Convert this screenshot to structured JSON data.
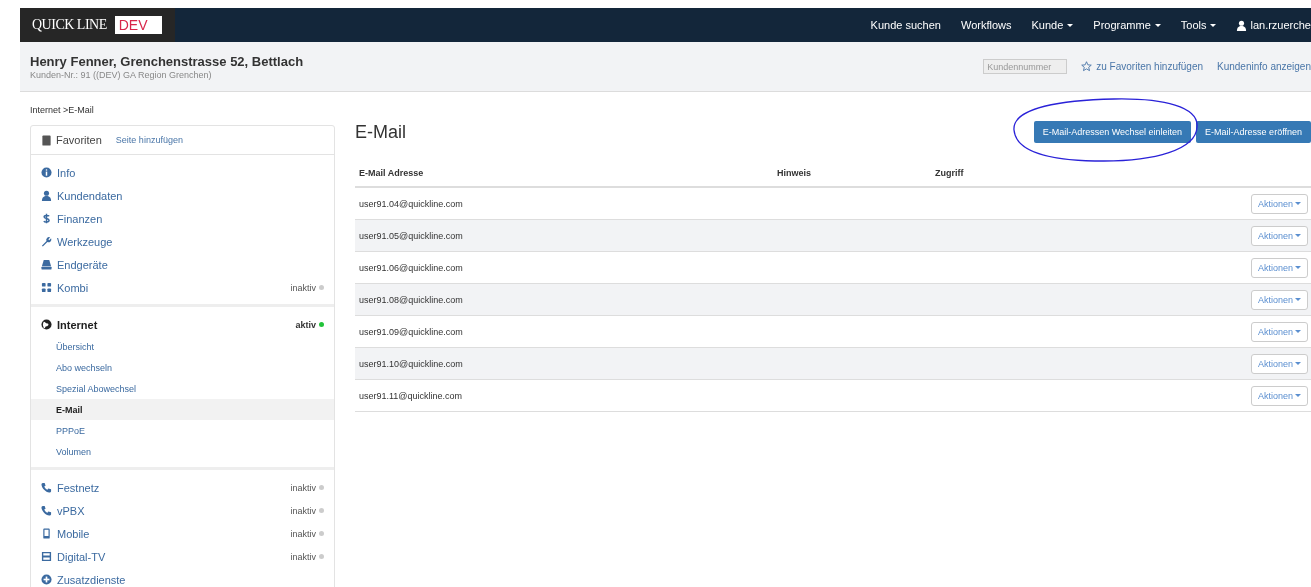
{
  "navbar": {
    "logo": "QUICK LINE",
    "env_badge": "DEV",
    "links": [
      {
        "label": "Kunde suchen",
        "dropdown": false
      },
      {
        "label": "Workflows",
        "dropdown": false
      },
      {
        "label": "Kunde",
        "dropdown": true
      },
      {
        "label": "Programme",
        "dropdown": true
      },
      {
        "label": "Tools",
        "dropdown": true
      }
    ],
    "user": "lan.rzuerche"
  },
  "customer_header": {
    "title": "Henry Fenner, Grenchenstrasse 52, Bettlach",
    "subtitle": "Kunden-Nr.: 91 ((DEV) GA Region Grenchen)",
    "search": {
      "placeholder": "Kundennummer"
    },
    "favorite_link": "zu Favoriten hinzufügen",
    "info_link": "Kundeninfo anzeigen"
  },
  "breadcrumb": "Internet >E-Mail",
  "sidebar": {
    "favorites": {
      "title": "Favoriten",
      "add_link": "Seite hinzufügen"
    },
    "groups": [
      {
        "items": [
          {
            "label": "Info",
            "expanded": false
          },
          {
            "label": "Kundendaten",
            "expanded": false
          },
          {
            "label": "Finanzen",
            "expanded": false
          },
          {
            "label": "Werkzeuge",
            "expanded": false
          },
          {
            "label": "Endgeräte",
            "expanded": false
          },
          {
            "label": "Kombi",
            "expanded": false,
            "status": {
              "text": "inaktiv",
              "color": "#cccccc"
            }
          }
        ]
      },
      {
        "items": [
          {
            "label": "Internet",
            "expanded": true,
            "status": {
              "text": "aktiv",
              "color": "#22c33a"
            },
            "children": [
              {
                "label": "Übersicht",
                "selected": false
              },
              {
                "label": "Abo wechseln",
                "selected": false
              },
              {
                "label": "Spezial Abowechsel",
                "selected": false
              },
              {
                "label": "E-Mail",
                "selected": true
              },
              {
                "label": "PPPoE",
                "selected": false
              },
              {
                "label": "Volumen",
                "selected": false
              }
            ]
          }
        ]
      },
      {
        "items": [
          {
            "label": "Festnetz",
            "expanded": false,
            "status": {
              "text": "inaktiv",
              "color": "#cccccc"
            }
          },
          {
            "label": "vPBX",
            "expanded": false,
            "status": {
              "text": "inaktiv",
              "color": "#cccccc"
            }
          },
          {
            "label": "Mobile",
            "expanded": false,
            "status": {
              "text": "inaktiv",
              "color": "#cccccc"
            }
          },
          {
            "label": "Digital-TV",
            "expanded": false,
            "status": {
              "text": "inaktiv",
              "color": "#cccccc"
            }
          },
          {
            "label": "Zusatzdienste",
            "expanded": false
          }
        ]
      }
    ]
  },
  "page": {
    "title": "E-Mail",
    "buttons": [
      {
        "label": "E-Mail-Adressen Wechsel einleiten",
        "circled": true
      },
      {
        "label": "E-Mail-Adresse eröffnen",
        "circled": false
      }
    ],
    "table": {
      "columns": [
        "E-Mail Adresse",
        "Hinweis",
        "Zugriff"
      ],
      "rows": [
        {
          "email": "user91.04@quickline.com",
          "action": "Aktionen"
        },
        {
          "email": "user91.05@quickline.com",
          "action": "Aktionen"
        },
        {
          "email": "user91.06@quickline.com",
          "action": "Aktionen"
        },
        {
          "email": "user91.08@quickline.com",
          "action": "Aktionen"
        },
        {
          "email": "user91.09@quickline.com",
          "action": "Aktionen"
        },
        {
          "email": "user91.10@quickline.com",
          "action": "Aktionen"
        },
        {
          "email": "user91.11@quickline.com",
          "action": "Aktionen"
        }
      ]
    }
  }
}
